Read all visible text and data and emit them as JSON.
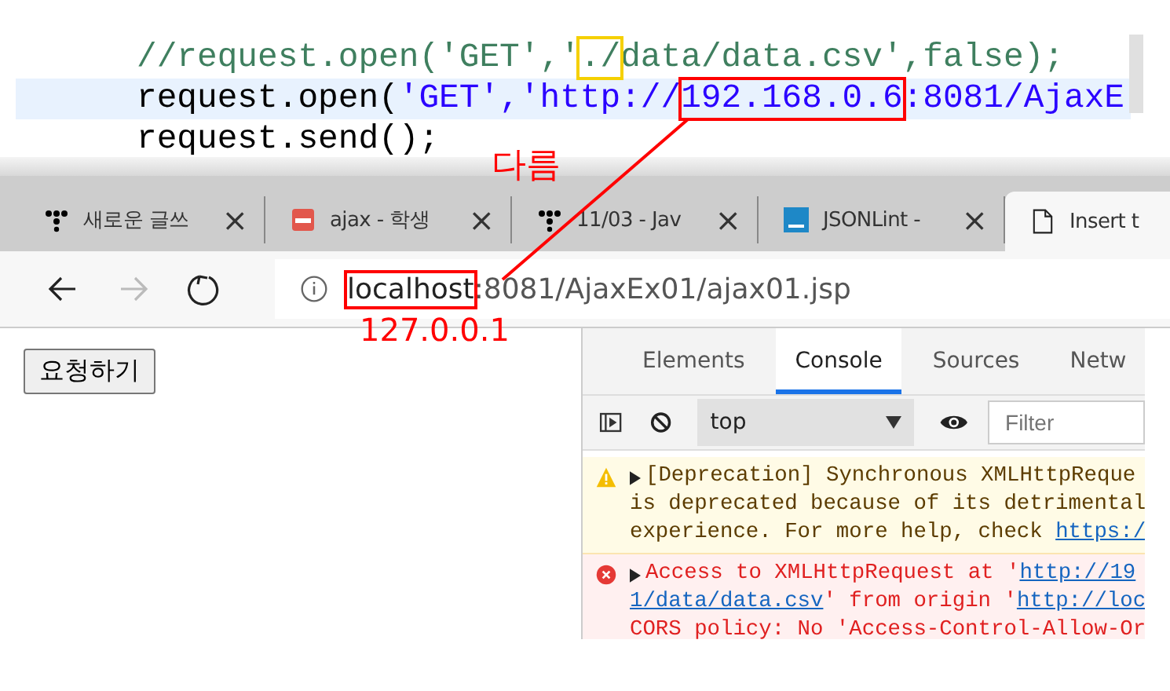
{
  "code_lines": [
    {
      "current": false,
      "segments": [
        {
          "text": "//request.open('GET','",
          "kind": "comment"
        },
        {
          "text": "./",
          "kind": "comment",
          "color": "#f5d000"
        },
        {
          "text": "data/data.csv',false);",
          "kind": "comment"
        }
      ]
    },
    {
      "current": true,
      "segments": [
        {
          "text": "request.open(",
          "kind": "code"
        },
        {
          "text": "'GET','http://",
          "kind": "string"
        },
        {
          "text": "192.168.0.6",
          "kind": "string",
          "color": "#ff0000"
        },
        {
          "text": ":8081/AjaxE",
          "kind": "string"
        }
      ]
    },
    {
      "current": false,
      "segments": [
        {
          "text": "request.send();",
          "kind": "code"
        }
      ]
    }
  ],
  "annotations": {
    "top_label": "다름",
    "bottom_label": "127.0.0.1"
  },
  "browser": {
    "tabs": [
      {
        "title": "새로운 글쓰",
        "kind": "dots",
        "selected": false,
        "close": "×"
      },
      {
        "title": "ajax - 학생",
        "kind": "pdf",
        "selected": false,
        "close": "×"
      },
      {
        "title": "11/03 - Jav",
        "kind": "dots",
        "selected": false,
        "close": "×"
      },
      {
        "title": "JSONLint -",
        "kind": "json",
        "selected": false,
        "close": "×"
      },
      {
        "title": "Insert t",
        "kind": "doc",
        "selected": true
      }
    ],
    "url_segments": [
      {
        "text": "localhost",
        "color": "#ff0000"
      },
      {
        "text": ":8081/AjaxEx01/ajax01.jsp"
      }
    ],
    "page_button": "요청하기",
    "devtools": {
      "tabs": [
        {
          "label": "Elements",
          "selected": false
        },
        {
          "label": "Console",
          "selected": true
        },
        {
          "label": "Sources",
          "selected": false
        },
        {
          "label": "Netw",
          "selected": false
        }
      ],
      "context": "top",
      "filter_placeholder": "Filter",
      "messages": [
        {
          "kind": "warning",
          "lines": [
            [
              {
                "text": "[Deprecation] Synchronous XMLHttpReque",
                "kind": "text"
              }
            ],
            [
              {
                "text": "is deprecated because of its detrimental",
                "kind": "text"
              }
            ],
            [
              {
                "text": "experience. For more help, check ",
                "kind": "text"
              },
              {
                "text": "https:/",
                "kind": "link"
              }
            ]
          ]
        },
        {
          "kind": "error",
          "lines": [
            [
              {
                "text": "Access to XMLHttpRequest at '",
                "kind": "text"
              },
              {
                "text": "http://19",
                "kind": "link"
              }
            ],
            [
              {
                "text": "1/data/data.csv",
                "kind": "link"
              },
              {
                "text": "' from origin '",
                "kind": "text"
              },
              {
                "text": "http://loc",
                "kind": "link"
              }
            ],
            [
              {
                "text": "CORS policy: No 'Access-Control-Allow-Or",
                "kind": "text"
              }
            ]
          ]
        }
      ]
    }
  }
}
